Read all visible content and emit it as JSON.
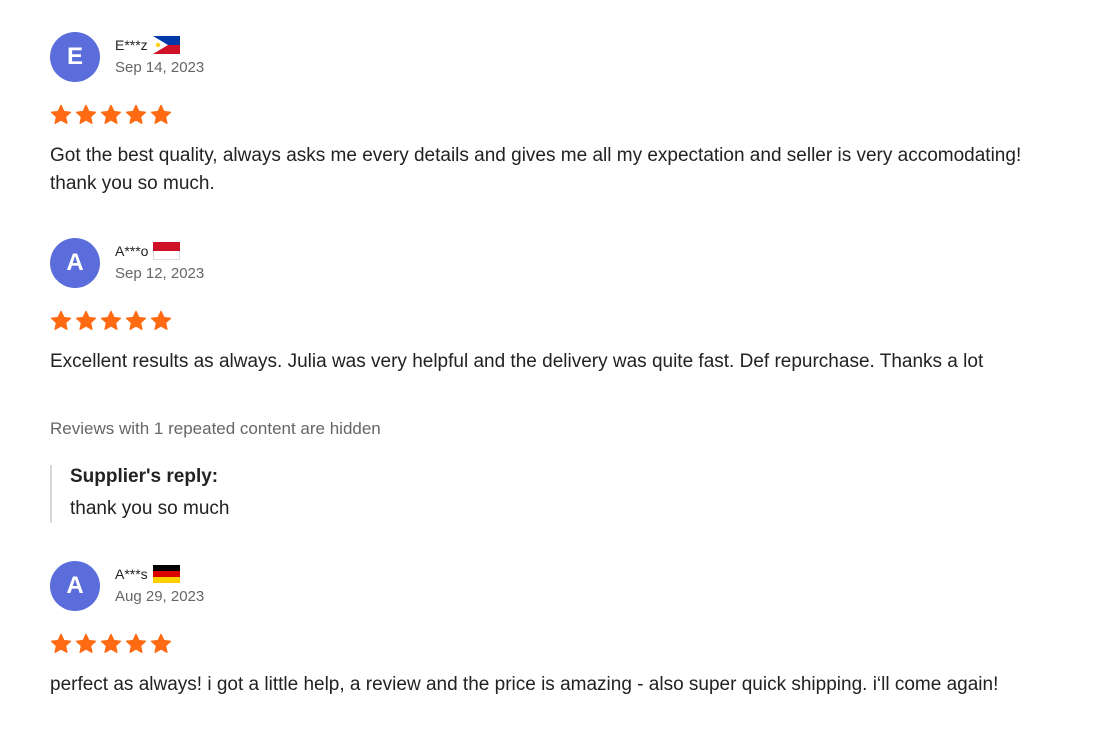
{
  "reviews": [
    {
      "initial": "E",
      "name": "E***z",
      "flag": "philippines-flag-icon",
      "date": "Sep 14, 2023",
      "rating": 5,
      "text": "Got the best quality, always asks me every details and gives me all my expectation and seller is very accomodating! thank you so much."
    },
    {
      "initial": "A",
      "name": "A***o",
      "flag": "indonesia-flag-icon",
      "date": "Sep 12, 2023",
      "rating": 5,
      "text": "Excellent results as always. Julia was very helpful and the delivery was quite fast. Def repurchase. Thanks a lot",
      "hidden_note": "Reviews with 1 repeated content are hidden",
      "reply_title": "Supplier's reply:",
      "reply_text": "thank you so much"
    },
    {
      "initial": "A",
      "name": "A***s",
      "flag": "germany-flag-icon",
      "date": "Aug 29, 2023",
      "rating": 5,
      "text": "perfect as always! i got a little help, a review and the price is amazing - also super quick shipping. i‘ll come again!"
    }
  ],
  "colors": {
    "avatar": "#5a6ddb",
    "star": "#ff6a13",
    "muted_text": "#666666"
  }
}
